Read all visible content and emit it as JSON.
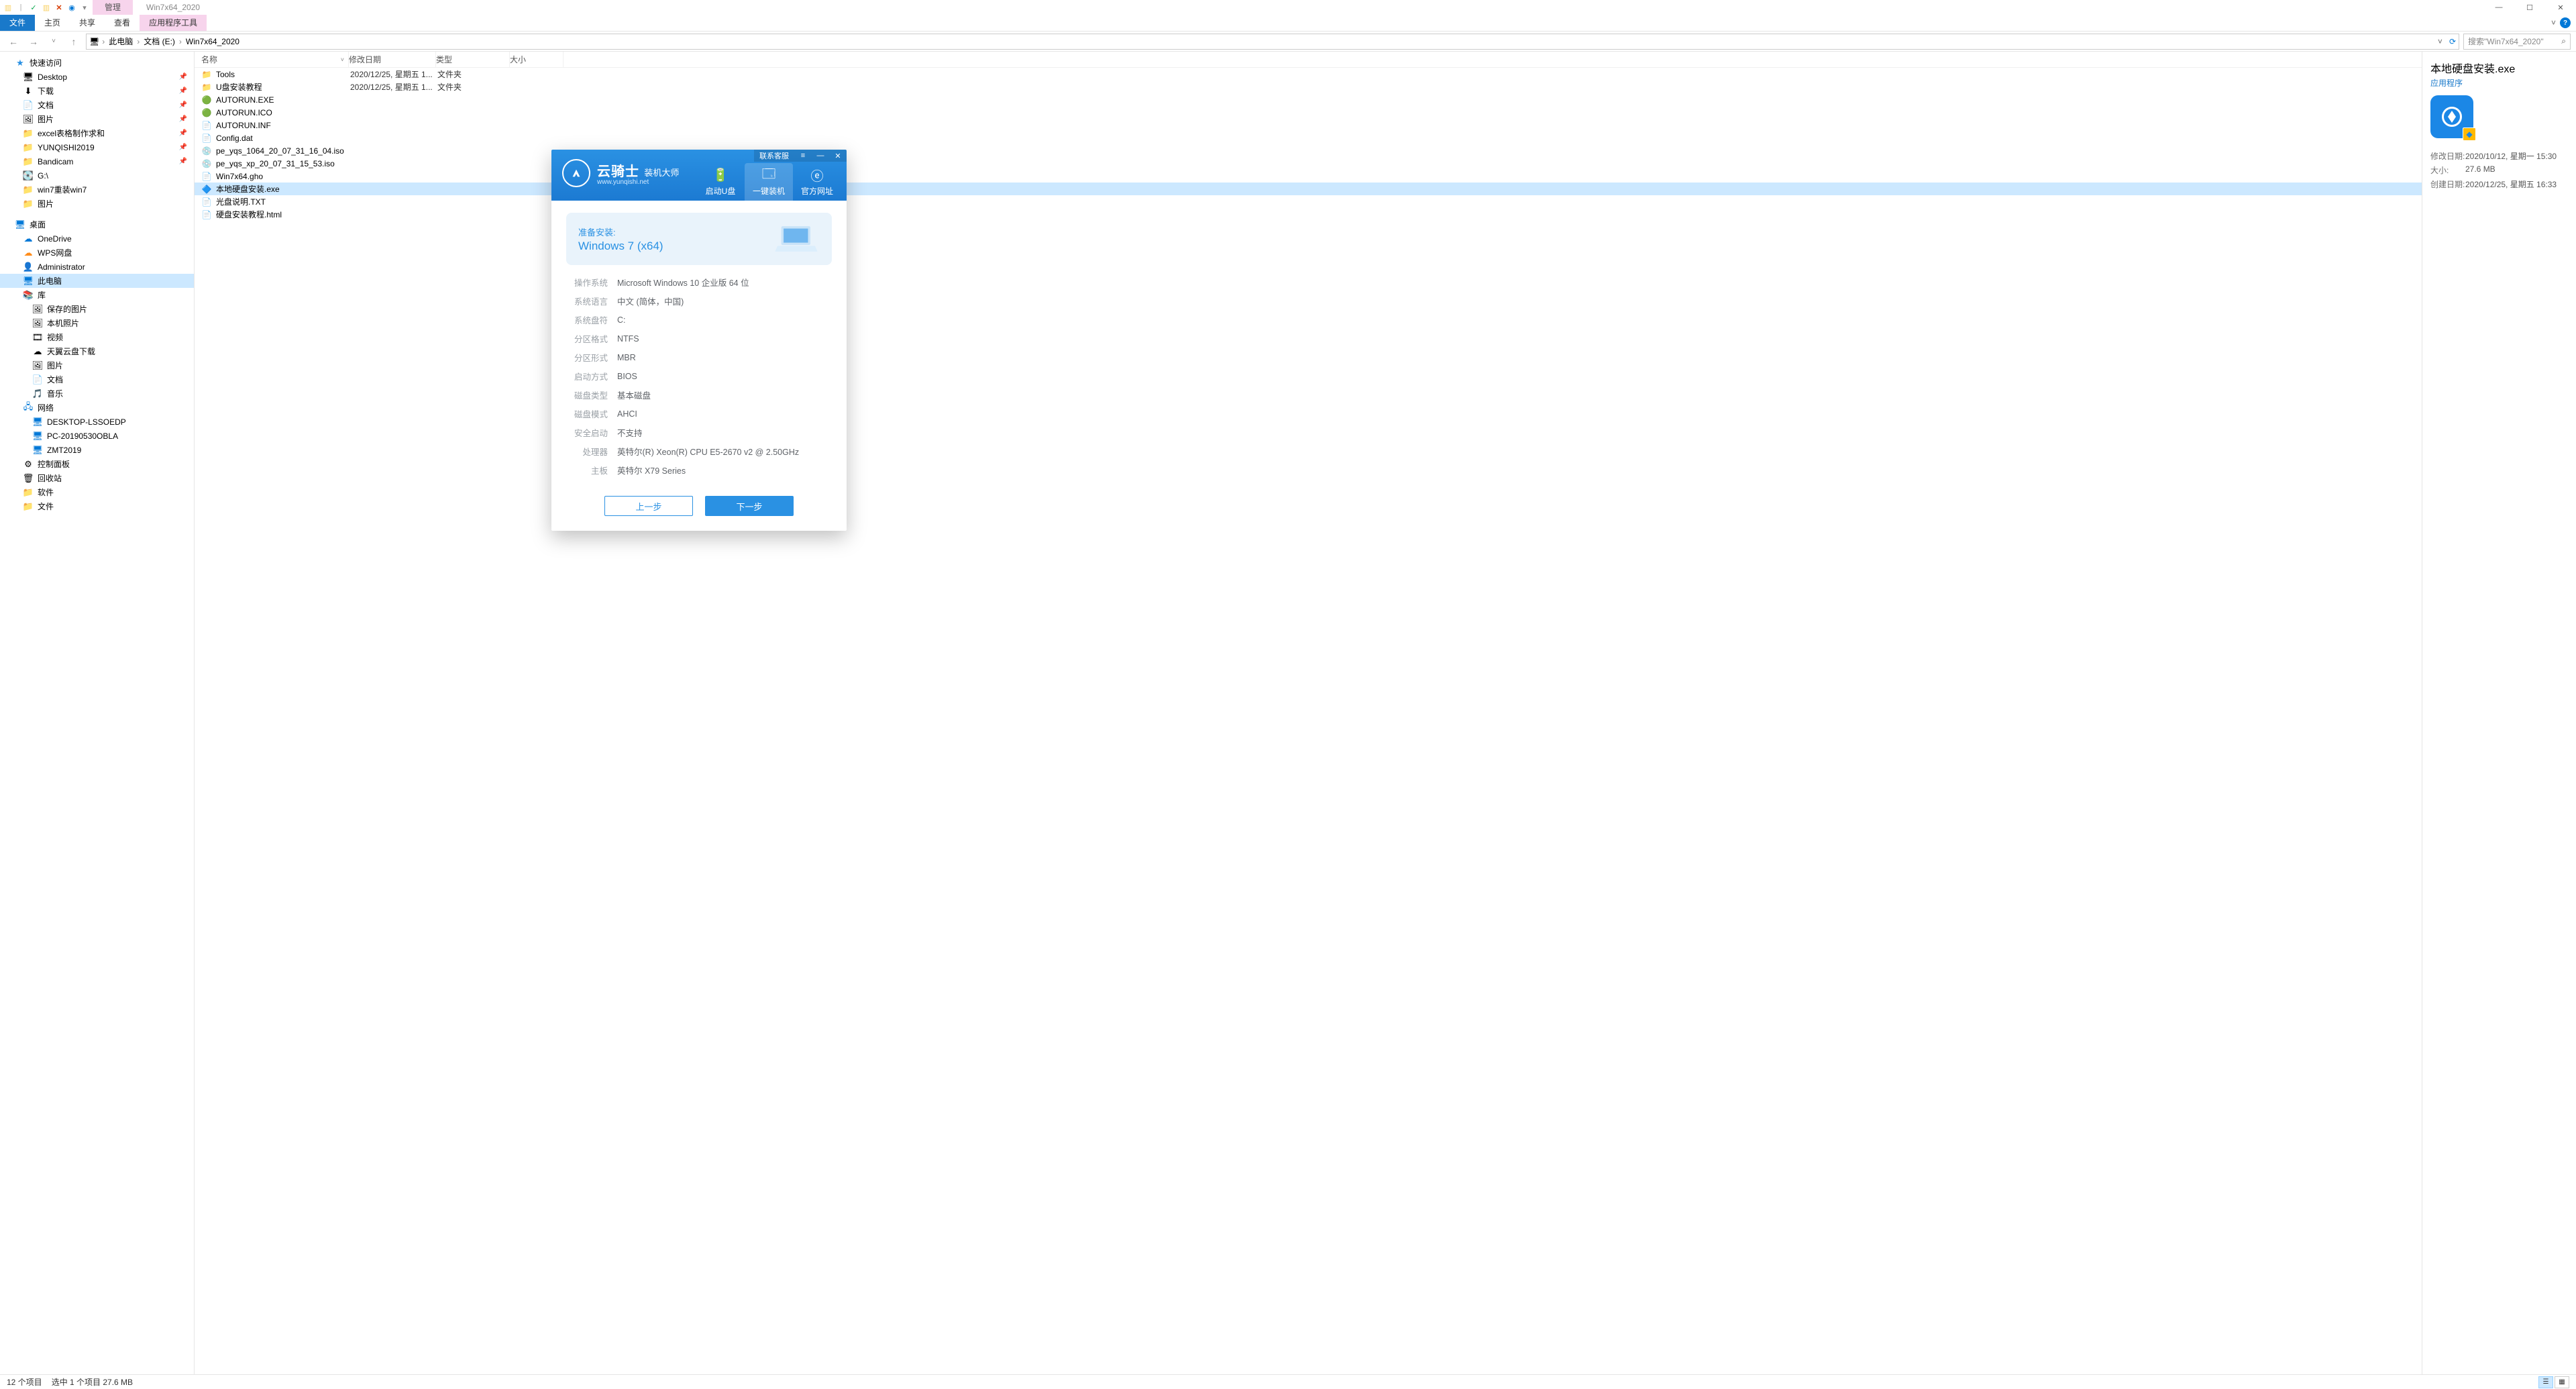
{
  "window": {
    "context_tab": "管理",
    "title": "Win7x64_2020"
  },
  "qat": {
    "save_check": "✓"
  },
  "ribbon": {
    "tabs": [
      "文件",
      "主页",
      "共享",
      "查看",
      "应用程序工具"
    ],
    "expand_hint": "˅"
  },
  "addressbar": {
    "root_icon": "🖥",
    "crumbs": [
      "此电脑",
      "文档 (E:)",
      "Win7x64_2020"
    ],
    "refresh": "⟳",
    "search_placeholder": "搜索\"Win7x64_2020\""
  },
  "nav": {
    "quick": {
      "label": "快速访问",
      "items": [
        {
          "icon": "🖥",
          "label": "Desktop",
          "pin": true
        },
        {
          "icon": "⬇",
          "label": "下载",
          "pin": true
        },
        {
          "icon": "📄",
          "label": "文档",
          "pin": true
        },
        {
          "icon": "🖼",
          "label": "图片",
          "pin": true
        },
        {
          "icon": "📁",
          "label": "excel表格制作求和",
          "pin": true
        },
        {
          "icon": "📁",
          "label": "YUNQISHI2019",
          "pin": true
        },
        {
          "icon": "📁",
          "label": "Bandicam",
          "pin": true
        },
        {
          "icon": "💽",
          "label": "G:\\"
        },
        {
          "icon": "📁",
          "label": "win7重装win7"
        },
        {
          "icon": "📁",
          "label": "图片"
        }
      ]
    },
    "desktop": {
      "label": "桌面",
      "items": [
        {
          "icon": "☁",
          "label": "OneDrive",
          "color": "#0078d7"
        },
        {
          "icon": "☁",
          "label": "WPS网盘",
          "color": "#ff8c1a"
        },
        {
          "icon": "👤",
          "label": "Administrator",
          "color": "#d9a441"
        },
        {
          "icon": "🖥",
          "label": "此电脑",
          "selected": true,
          "color": "#0078d7"
        },
        {
          "icon": "📚",
          "label": "库",
          "color": "#d9a441"
        }
      ]
    },
    "libs": [
      {
        "icon": "🖼",
        "label": "保存的图片"
      },
      {
        "icon": "🖼",
        "label": "本机照片"
      },
      {
        "icon": "🎞",
        "label": "视频"
      },
      {
        "icon": "☁",
        "label": "天翼云盘下载"
      },
      {
        "icon": "🖼",
        "label": "图片"
      },
      {
        "icon": "📄",
        "label": "文档"
      },
      {
        "icon": "🎵",
        "label": "音乐"
      }
    ],
    "network": {
      "label": "网络",
      "items": [
        {
          "icon": "🖥",
          "label": "DESKTOP-LSSOEDP"
        },
        {
          "icon": "🖥",
          "label": "PC-20190530OBLA"
        },
        {
          "icon": "🖥",
          "label": "ZMT2019"
        }
      ]
    },
    "misc": [
      {
        "icon": "⚙",
        "label": "控制面板"
      },
      {
        "icon": "🗑",
        "label": "回收站"
      },
      {
        "icon": "📁",
        "label": "软件"
      },
      {
        "icon": "📁",
        "label": "文件"
      }
    ]
  },
  "columns": {
    "name": "名称",
    "date": "修改日期",
    "type": "类型",
    "size": "大小"
  },
  "files": [
    {
      "icon": "📁",
      "name": "Tools",
      "date": "2020/12/25, 星期五 1...",
      "type": "文件夹"
    },
    {
      "icon": "📁",
      "name": "U盘安装教程",
      "date": "2020/12/25, 星期五 1...",
      "type": "文件夹"
    },
    {
      "icon": "🟢",
      "name": "AUTORUN.EXE",
      "date": "",
      "type": ""
    },
    {
      "icon": "🟢",
      "name": "AUTORUN.ICO",
      "date": "",
      "type": ""
    },
    {
      "icon": "📄",
      "name": "AUTORUN.INF",
      "date": "",
      "type": ""
    },
    {
      "icon": "📄",
      "name": "Config.dat",
      "date": "",
      "type": ""
    },
    {
      "icon": "💿",
      "name": "pe_yqs_1064_20_07_31_16_04.iso",
      "date": "",
      "type": ""
    },
    {
      "icon": "💿",
      "name": "pe_yqs_xp_20_07_31_15_53.iso",
      "date": "",
      "type": ""
    },
    {
      "icon": "📄",
      "name": "Win7x64.gho",
      "date": "",
      "type": ""
    },
    {
      "icon": "🔷",
      "name": "本地硬盘安装.exe",
      "date": "",
      "type": "",
      "selected": true
    },
    {
      "icon": "📄",
      "name": "光盘说明.TXT",
      "date": "",
      "type": ""
    },
    {
      "icon": "📄",
      "name": "硬盘安装教程.html",
      "date": "",
      "type": ""
    }
  ],
  "details": {
    "title": "本地硬盘安装.exe",
    "subtitle": "应用程序",
    "props": [
      {
        "k": "修改日期:",
        "v": "2020/10/12, 星期一 15:30"
      },
      {
        "k": "大小:",
        "v": "27.6 MB"
      },
      {
        "k": "创建日期:",
        "v": "2020/12/25, 星期五 16:33"
      }
    ]
  },
  "statusbar": {
    "count": "12 个项目",
    "selected": "选中 1 个项目  27.6 MB"
  },
  "dialog": {
    "brand_cn": "云骑士",
    "brand_sub": "装机大师",
    "brand_url": "www.yunqishi.net",
    "contact": "联系客服",
    "tabs": [
      {
        "icon": "🔋",
        "label": "启动U盘"
      },
      {
        "icon": "🗔",
        "label": "一键装机",
        "active": true
      },
      {
        "icon": "ⓔ",
        "label": "官方网址"
      }
    ],
    "install_title": "准备安装:",
    "install_target": "Windows 7 (x64)",
    "props": [
      {
        "k": "操作系统",
        "v": "Microsoft Windows 10 企业版 64 位"
      },
      {
        "k": "系统语言",
        "v": "中文 (简体，中国)"
      },
      {
        "k": "系统盘符",
        "v": "C:"
      },
      {
        "k": "分区格式",
        "v": "NTFS"
      },
      {
        "k": "分区形式",
        "v": "MBR"
      },
      {
        "k": "启动方式",
        "v": "BIOS"
      },
      {
        "k": "磁盘类型",
        "v": "基本磁盘"
      },
      {
        "k": "磁盘模式",
        "v": "AHCI"
      },
      {
        "k": "安全启动",
        "v": "不支持"
      },
      {
        "k": "处理器",
        "v": "英特尔(R) Xeon(R) CPU E5-2670 v2 @ 2.50GHz"
      },
      {
        "k": "主板",
        "v": "英特尔 X79 Series"
      }
    ],
    "btn_prev": "上一步",
    "btn_next": "下一步"
  }
}
